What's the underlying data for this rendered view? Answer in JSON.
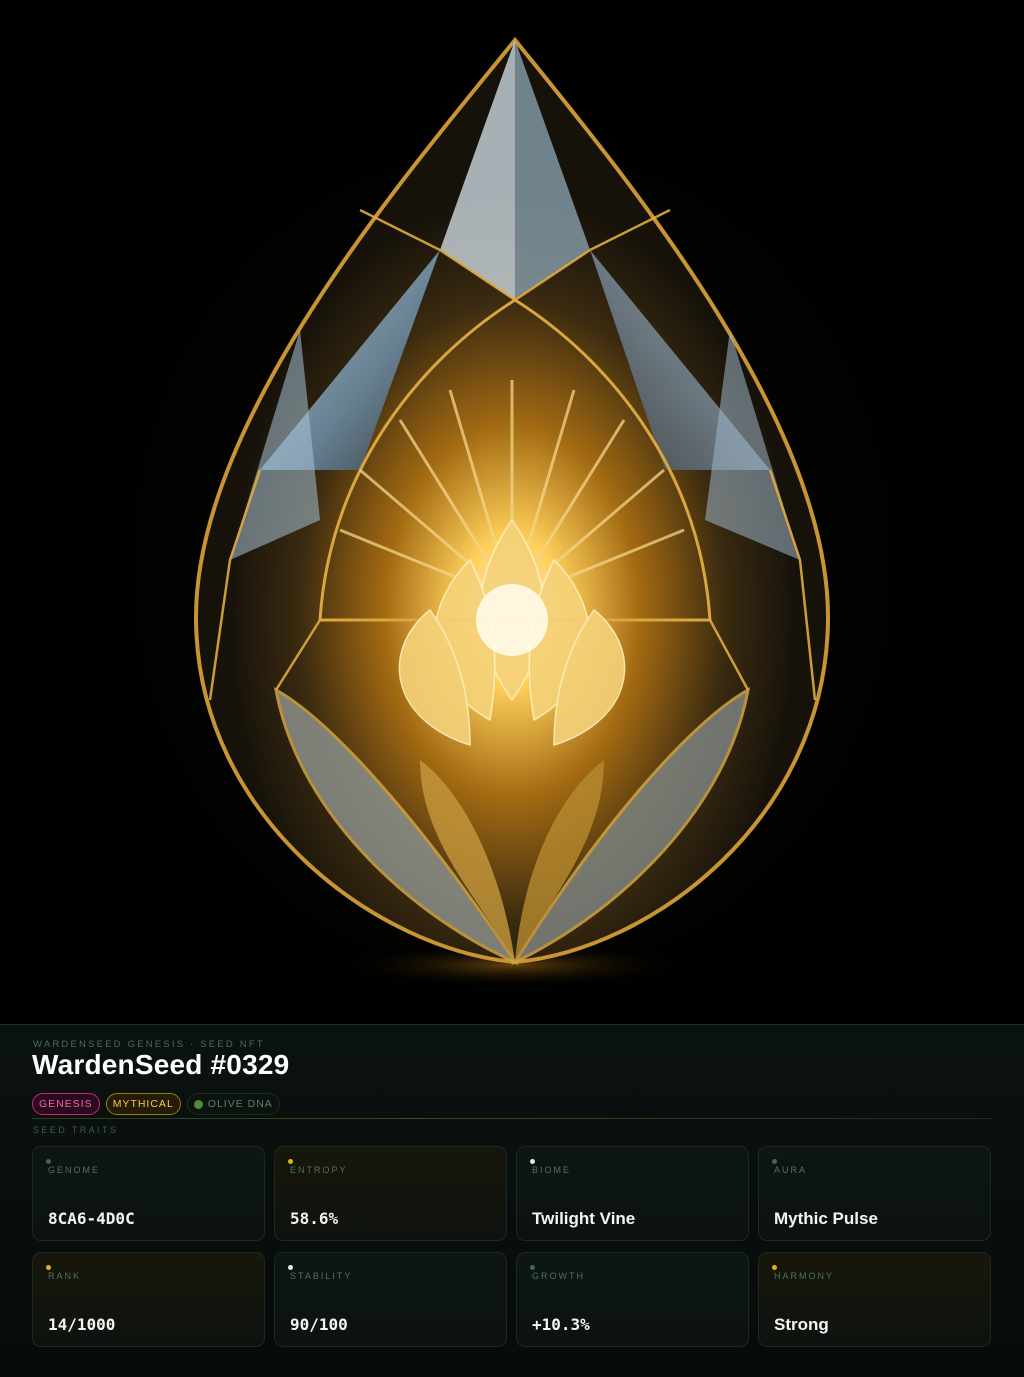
{
  "header": {
    "eyebrow": "WARDENSEED GENESIS · SEED NFT",
    "title": "WardenSeed #0329"
  },
  "badges": {
    "genesis": "GENESIS",
    "mythical": "MYTHICAL",
    "dna": "OLIVE DNA"
  },
  "traits": {
    "section_label": "SEED TRAITS",
    "items": [
      {
        "label": "GENOME",
        "value": "8CA6-4D0C",
        "dot_color": "#3f6b4a"
      },
      {
        "label": "ENTROPY",
        "value": "58.6%",
        "dot_color": "#e2b21c"
      },
      {
        "label": "BIOME",
        "value": "Twilight Vine",
        "dot_color": "#e8e8e8"
      },
      {
        "label": "AURA",
        "value": "Mythic Pulse",
        "dot_color": "#3f6b4a"
      },
      {
        "label": "RANK",
        "value": "14/1000",
        "dot_color": "#e2b21c"
      },
      {
        "label": "STABILITY",
        "value": "90/100",
        "dot_color": "#e8e8e8"
      },
      {
        "label": "GROWTH",
        "value": "+10.3%",
        "dot_color": "#3f6b4a"
      },
      {
        "label": "HARMONY",
        "value": "Strong",
        "dot_color": "#e2b21c"
      }
    ]
  },
  "colors": {
    "genesis": "#ff5cb4",
    "mythical": "#f1cc51",
    "dna_dot": "#4e8a3a",
    "gold": "#e2b21c"
  }
}
